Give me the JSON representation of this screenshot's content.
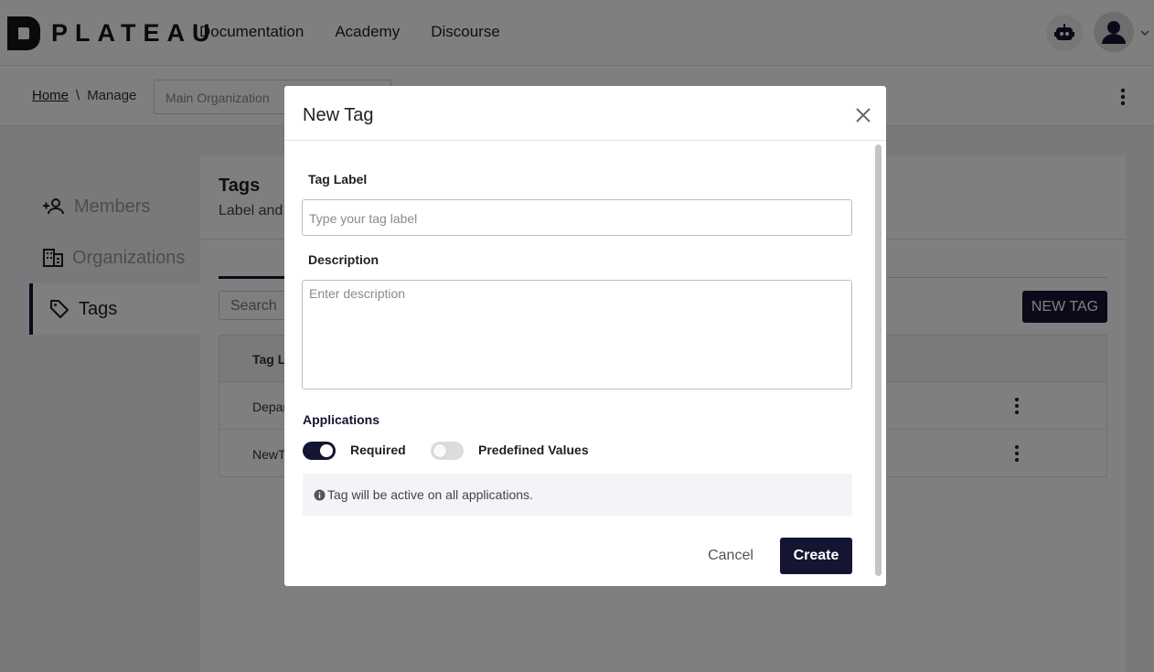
{
  "brand": {
    "name": "PLATEAU"
  },
  "topnav": {
    "items": [
      "Documentation",
      "Academy",
      "Discourse"
    ]
  },
  "breadcrumb": {
    "home": "Home",
    "separator": "\\",
    "current": "Manage",
    "org_select": "Main Organization"
  },
  "sidebar": {
    "items": [
      {
        "label": "Members",
        "icon": "add-person-icon"
      },
      {
        "label": "Organizations",
        "icon": "building-icon"
      },
      {
        "label": "Tags",
        "icon": "tag-icon",
        "active": true
      }
    ]
  },
  "panel": {
    "title": "Tags",
    "subtitle": "Label and",
    "search_placeholder": "Search",
    "new_tag_label": "NEW TAG",
    "table": {
      "header": "Tag L",
      "rows": [
        "Depar",
        "NewT"
      ]
    }
  },
  "modal": {
    "title": "New Tag",
    "tag_label_label": "Tag Label",
    "tag_label_placeholder": "Type your tag label",
    "description_label": "Description",
    "description_placeholder": "Enter description",
    "applications_label": "Applications",
    "required_label": "Required",
    "required_on": true,
    "predefined_label": "Predefined Values",
    "predefined_on": false,
    "info_text": "Tag will be active on all applications.",
    "cancel_label": "Cancel",
    "create_label": "Create"
  },
  "colors": {
    "primary": "#141433",
    "overlay": "rgba(0,0,0,0.5)"
  }
}
